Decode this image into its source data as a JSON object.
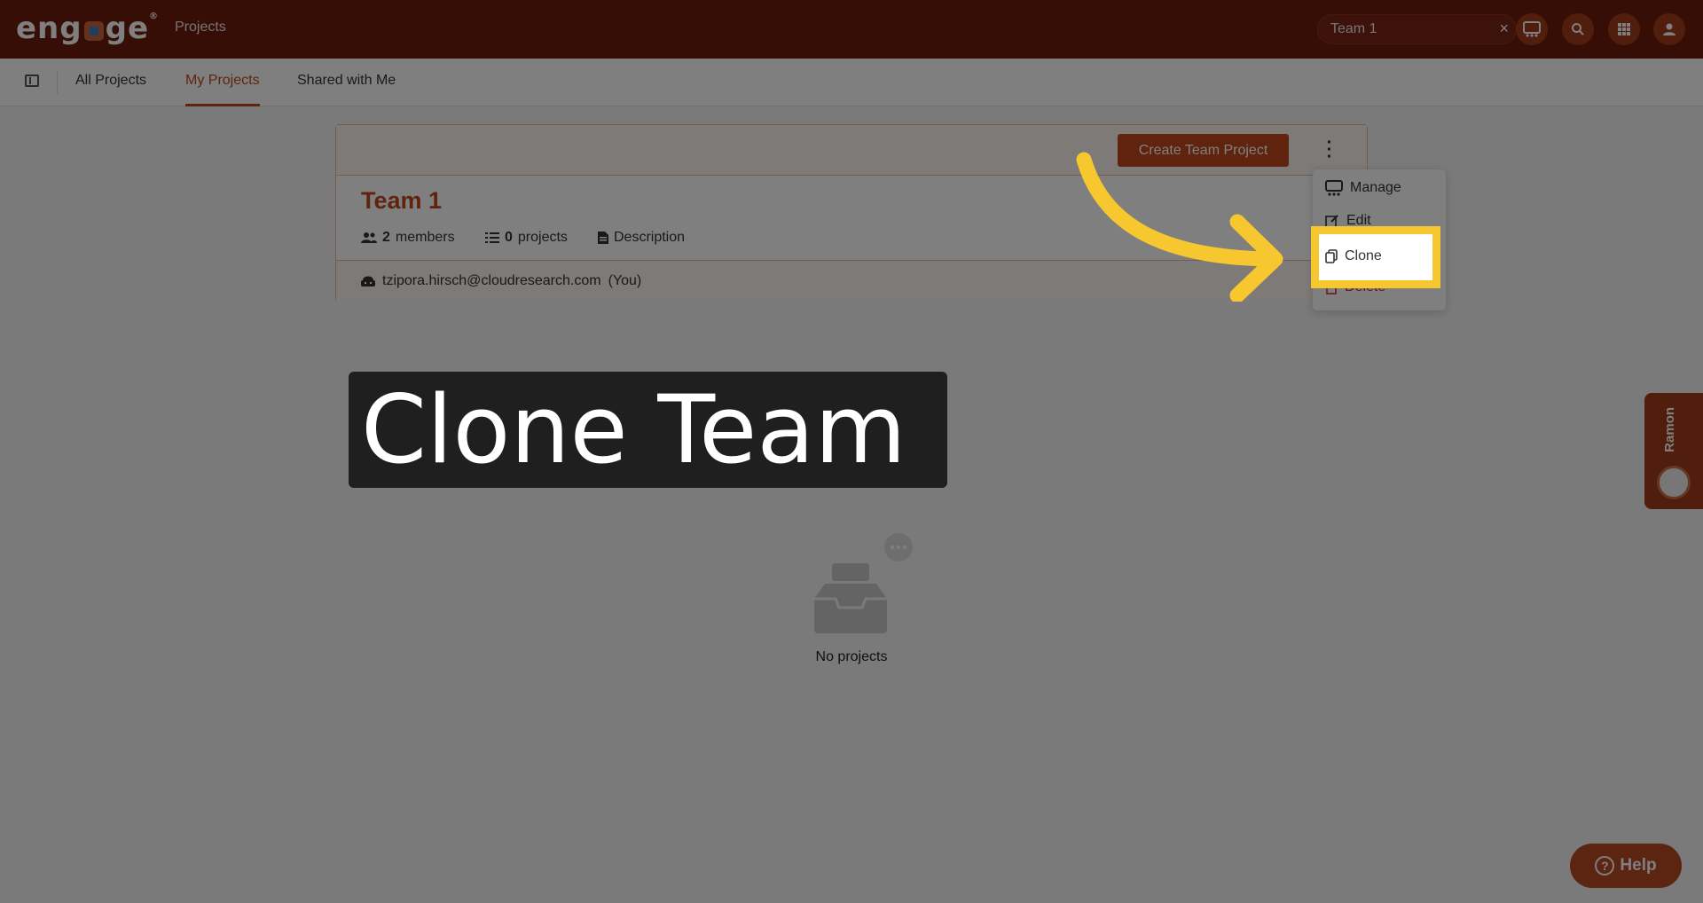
{
  "header": {
    "logo": "engage",
    "title": "Projects",
    "team_search": "Team 1",
    "clear_icon": "×"
  },
  "tabs": [
    {
      "label": "All Projects"
    },
    {
      "label": "My Projects"
    },
    {
      "label": "Shared with Me"
    }
  ],
  "team_card": {
    "create_label": "Create Team Project",
    "name": "Team 1",
    "members_count": "2",
    "members_label": "members",
    "projects_count": "0",
    "projects_label": "projects",
    "description_label": "Description",
    "owner_email": "tzipora.hirsch@cloudresearch.com",
    "owner_you": "(You)"
  },
  "menu": {
    "items": [
      {
        "label": "Manage"
      },
      {
        "label": "Edit"
      },
      {
        "label": "Clone"
      },
      {
        "label": "Delete"
      }
    ]
  },
  "caption": "Clone Team",
  "empty_state": {
    "label": "No projects"
  },
  "side_tab": {
    "label": "Ramon"
  },
  "help": {
    "label": "Help"
  },
  "colors": {
    "brand": "#6e1d0c",
    "accent": "#c0461b",
    "highlight": "#f7c72f"
  }
}
